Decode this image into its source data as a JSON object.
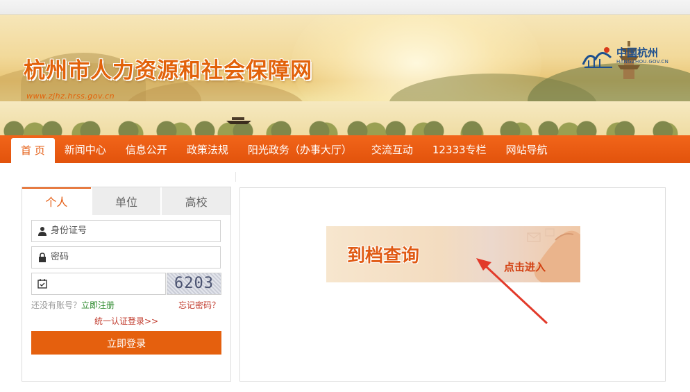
{
  "header": {
    "site_title": "杭州市人力资源和社会保障网",
    "site_url": "www.zjhz.hrss.gov.cn",
    "partner_logo": {
      "cn": "中国杭州",
      "en": "HANGZHOU.GOV.CN"
    }
  },
  "nav": {
    "items": [
      {
        "label": "首 页"
      },
      {
        "label": "新闻中心"
      },
      {
        "label": "信息公开"
      },
      {
        "label": "政策法规"
      },
      {
        "label": "阳光政务（办事大厅）"
      },
      {
        "label": "交流互动"
      },
      {
        "label": "12333专栏"
      },
      {
        "label": "网站导航"
      }
    ]
  },
  "login": {
    "tabs": [
      {
        "label": "个人"
      },
      {
        "label": "单位"
      },
      {
        "label": "高校"
      }
    ],
    "id_placeholder": "身份证号",
    "password_placeholder": "密码",
    "captcha_code": "6203",
    "no_account_text": "还没有账号？",
    "register_link": "立即注册",
    "forgot_link": "忘记密码？",
    "unified_login": "统一认证登录>>",
    "submit_label": "立即登录"
  },
  "main": {
    "banner_title": "到档查询",
    "banner_cta": "点击进入"
  },
  "colors": {
    "accent": "#e5600e",
    "nav": "#ec5c14",
    "link_green": "#2d8a2d",
    "link_red": "#c0392b"
  }
}
